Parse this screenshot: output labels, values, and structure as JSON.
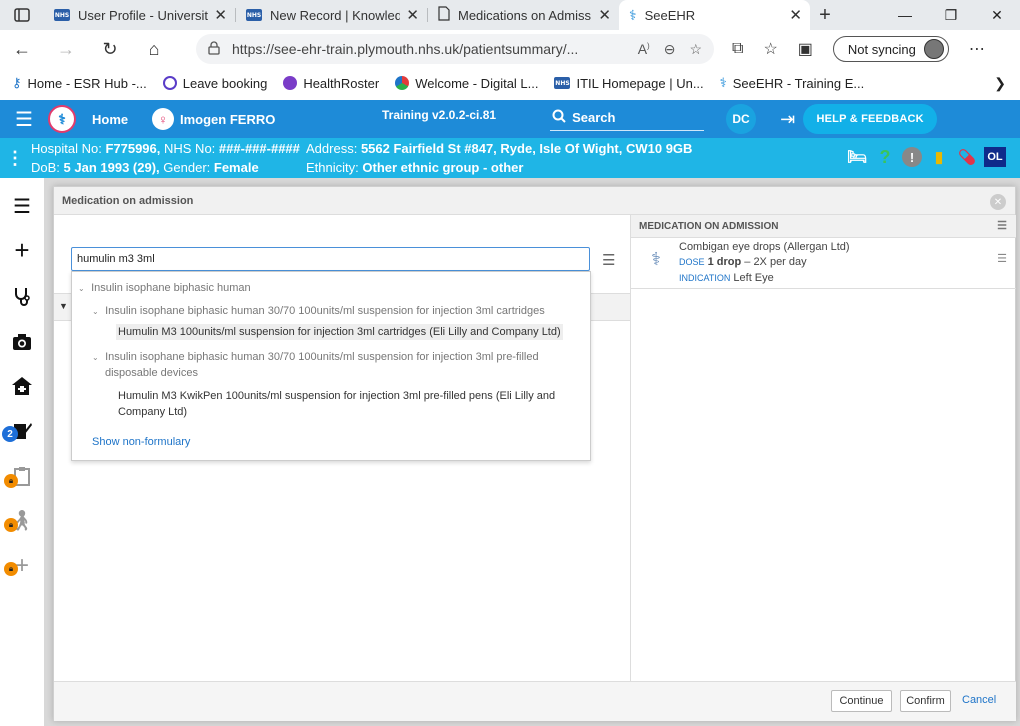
{
  "browser": {
    "tabs": [
      {
        "title": "User Profile - University",
        "favicon": "nhs-icon"
      },
      {
        "title": "New Record | Knowledg",
        "favicon": "nhs-icon"
      },
      {
        "title": "Medications on Admiss",
        "favicon": "page-icon"
      },
      {
        "title": "SeeEHR",
        "favicon": "seeehr-icon"
      }
    ],
    "url": "https://see-ehr-train.plymouth.nhs.uk/patientsummary/...",
    "sync_label": "Not syncing",
    "favorites": [
      {
        "label": "Home - ESR Hub -..."
      },
      {
        "label": "Leave booking"
      },
      {
        "label": "HealthRoster"
      },
      {
        "label": "Welcome - Digital L..."
      },
      {
        "label": "ITIL Homepage | Un..."
      },
      {
        "label": "SeeEHR - Training E..."
      }
    ]
  },
  "app": {
    "home_label": "Home",
    "patient_name": "Imogen FERRO",
    "version": "Training v2.0.2-ci.81",
    "search_label": "Search",
    "user_initials": "DC",
    "help_label": "HELP & FEEDBACK"
  },
  "banner": {
    "hospital_label": "Hospital No:",
    "hospital_no": "F775996,",
    "nhs_label": "NHS No:",
    "nhs_no": "###-###-####",
    "address_label": "Address:",
    "address": "5562 Fairfield St #847, Ryde, Isle Of Wight, CW10 9GB",
    "dob_label": "DoB:",
    "dob": "5 Jan 1993 (29),",
    "gender_label": "Gender:",
    "gender": "Female",
    "ethnicity_label": "Ethnicity:",
    "ethnicity": "Other ethnic group - other",
    "ol_label": "OL"
  },
  "leftnav": {
    "badge_count": "2"
  },
  "modal": {
    "title": "Medication on admission",
    "search_value": "humulin m3 3ml",
    "dropdown": {
      "group": "Insulin isophane biphasic human",
      "sub1": "Insulin isophane biphasic human 30/70 100units/ml suspension for injection 3ml cartridges",
      "sub1_leaf": "Humulin M3 100units/ml suspension for injection 3ml cartridges (Eli Lilly and Company Ltd)",
      "sub2_line1": "Insulin isophane biphasic human 30/70 100units/ml suspension for injection 3ml pre-filled",
      "sub2_line2": "disposable devices",
      "sub2_leaf_line1": "Humulin M3 KwikPen 100units/ml suspension for injection 3ml pre-filled pens (Eli Lilly and",
      "sub2_leaf_line2": "Company Ltd)",
      "show_nonformulary": "Show non-formulary"
    },
    "right_panel": {
      "header": "MEDICATION ON ADMISSION",
      "meds": [
        {
          "name": "Combigan eye drops (Allergan Ltd)",
          "dose_label": "DOSE",
          "dose_value": "1 drop",
          "frequency": "– 2X per day",
          "indication_label": "INDICATION",
          "indication_value": "Left Eye"
        }
      ]
    },
    "footer": {
      "continue_label": "Continue",
      "confirm_label": "Confirm",
      "cancel_label": "Cancel"
    }
  }
}
